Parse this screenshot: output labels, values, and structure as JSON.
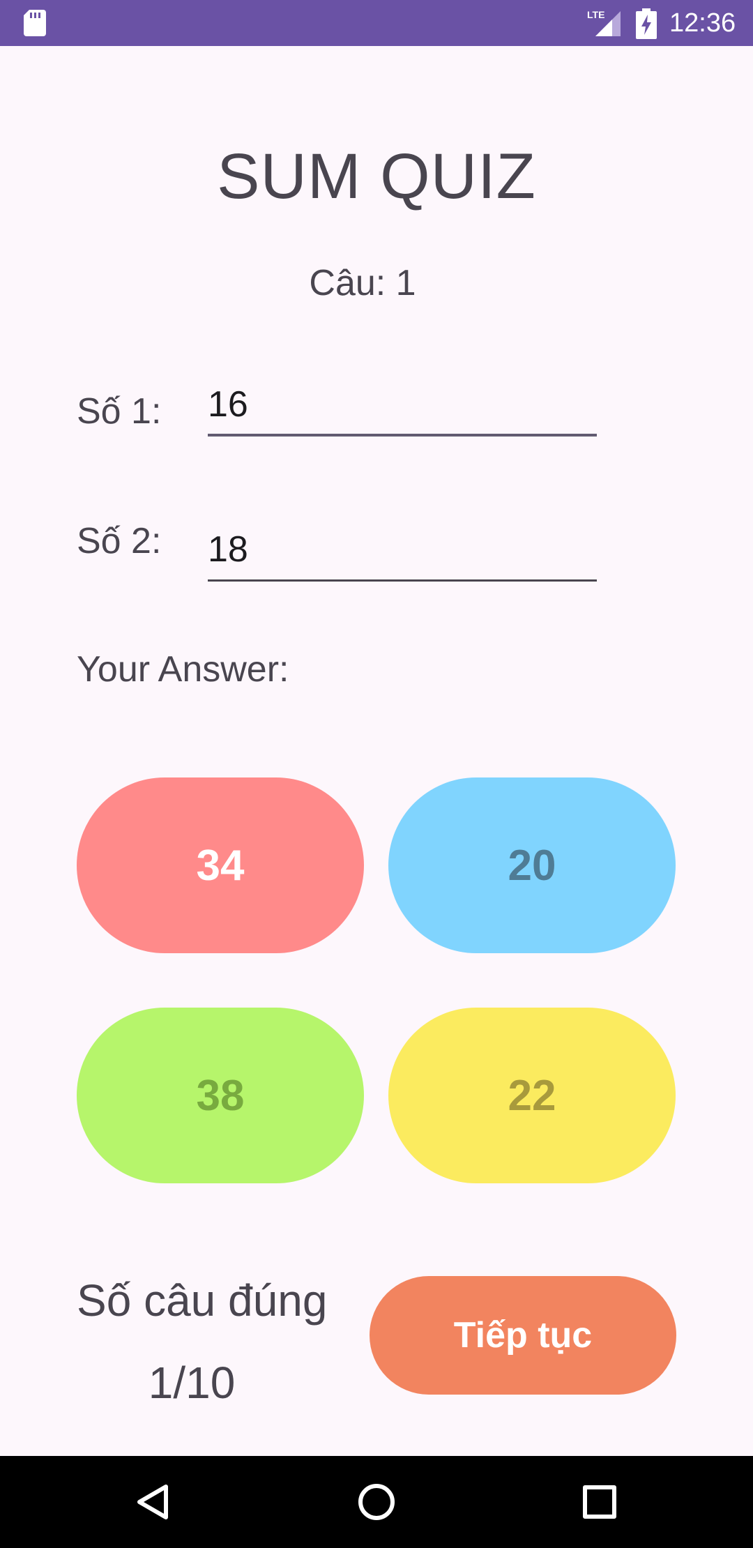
{
  "status_bar": {
    "time": "12:36",
    "network": "LTE",
    "background": "#6a52a5",
    "icons": [
      "sd-card-icon",
      "lte-signal-icon",
      "battery-charging-icon"
    ]
  },
  "title": "SUM QUIZ",
  "question": {
    "label": "Câu: 1"
  },
  "number1": {
    "label": "Số 1:",
    "value": "16"
  },
  "number2": {
    "label": "Số 2:",
    "value": "18"
  },
  "answer_label": "Your Answer:",
  "options": [
    {
      "label": "34",
      "bg": "#ff8a8a",
      "fg": "#ffffff"
    },
    {
      "label": "20",
      "bg": "#80d4fe",
      "fg": "#4f7c95"
    },
    {
      "label": "38",
      "bg": "#b6f56b",
      "fg": "#78aa3f"
    },
    {
      "label": "22",
      "bg": "#fbeb5f",
      "fg": "#a89a3c"
    }
  ],
  "score": {
    "label": "Số câu đúng",
    "value": "1/10"
  },
  "next_button": {
    "label": "Tiếp tục",
    "bg": "#f2845f"
  },
  "nav_bar": {
    "icons": [
      "back-icon",
      "home-icon",
      "recents-icon"
    ]
  }
}
